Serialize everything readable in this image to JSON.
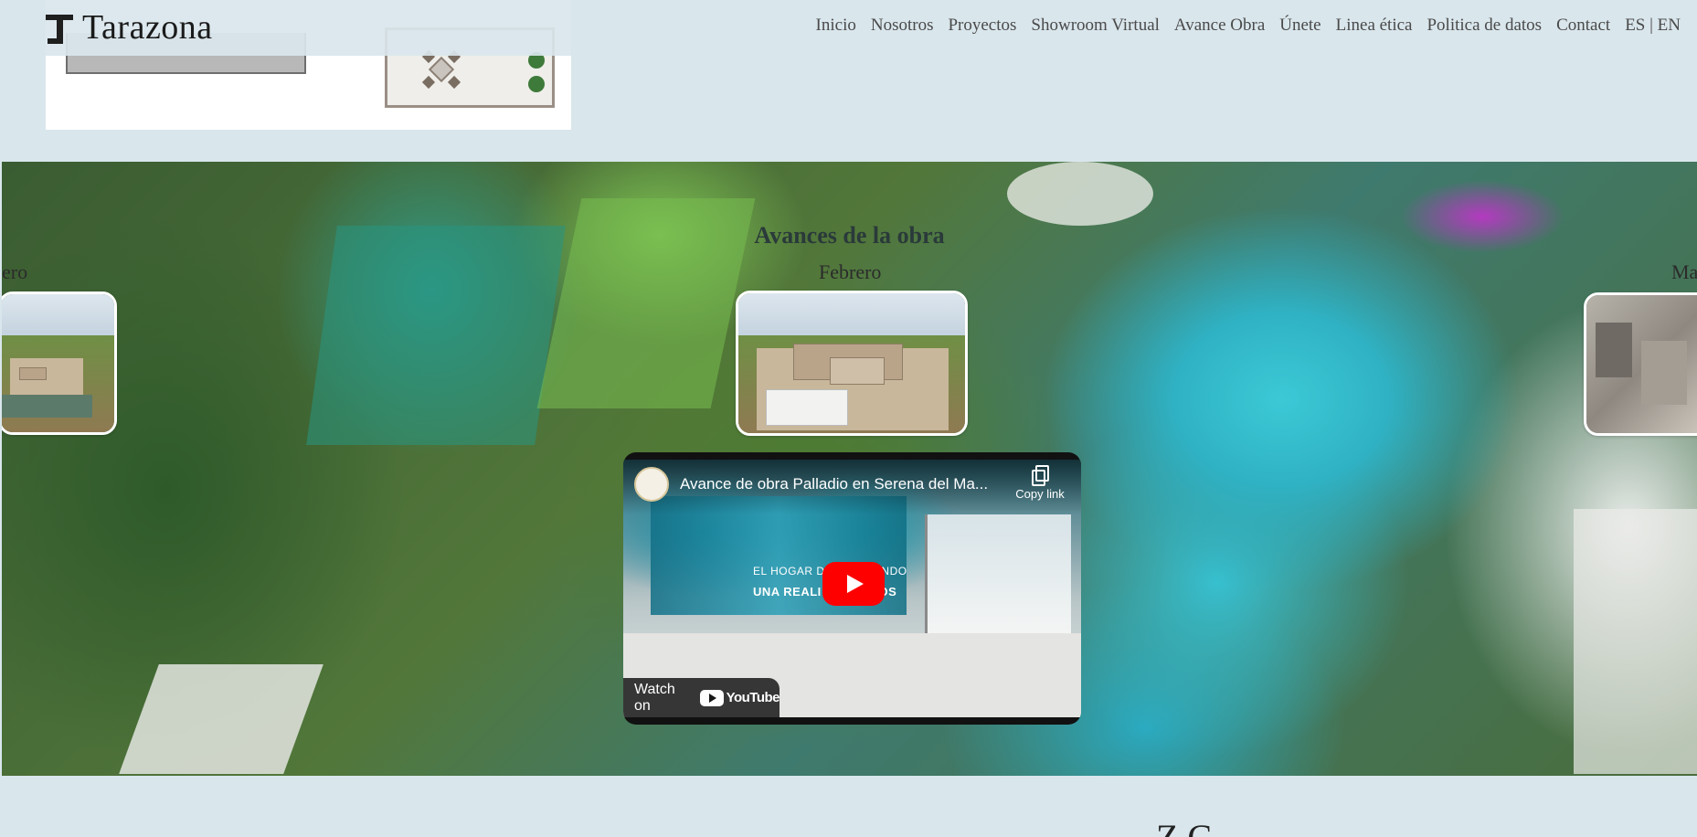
{
  "brand": {
    "name": "Tarazona"
  },
  "nav": {
    "items": [
      {
        "label": "Inicio"
      },
      {
        "label": "Nosotros"
      },
      {
        "label": "Proyectos"
      },
      {
        "label": "Showroom Virtual"
      },
      {
        "label": "Avance Obra"
      },
      {
        "label": "Únete"
      },
      {
        "label": "Linea ética"
      },
      {
        "label": "Politica de datos"
      },
      {
        "label": "Contact"
      },
      {
        "label": "ES | EN"
      }
    ]
  },
  "hero": {
    "title": "Avances de la obra",
    "slides": [
      {
        "month": "ero"
      },
      {
        "month": "Febrero"
      },
      {
        "month": "Ma"
      }
    ]
  },
  "video": {
    "title": "Avance de obra Palladio en Serena del Ma...",
    "copy_label": "Copy link",
    "overlay_line1": "EL HOGAR D          ESTÁ SIENDO",
    "overlay_line2": "UNA REALI           NOSOTROS",
    "watch_on": "Watch on",
    "yt_word": "YouTube"
  },
  "bottom": {
    "title_partial": "Z    C"
  },
  "colors": {
    "page_bg": "#d9e6ec",
    "play_red": "#ff0000",
    "nav_text": "#4a4a4a"
  }
}
